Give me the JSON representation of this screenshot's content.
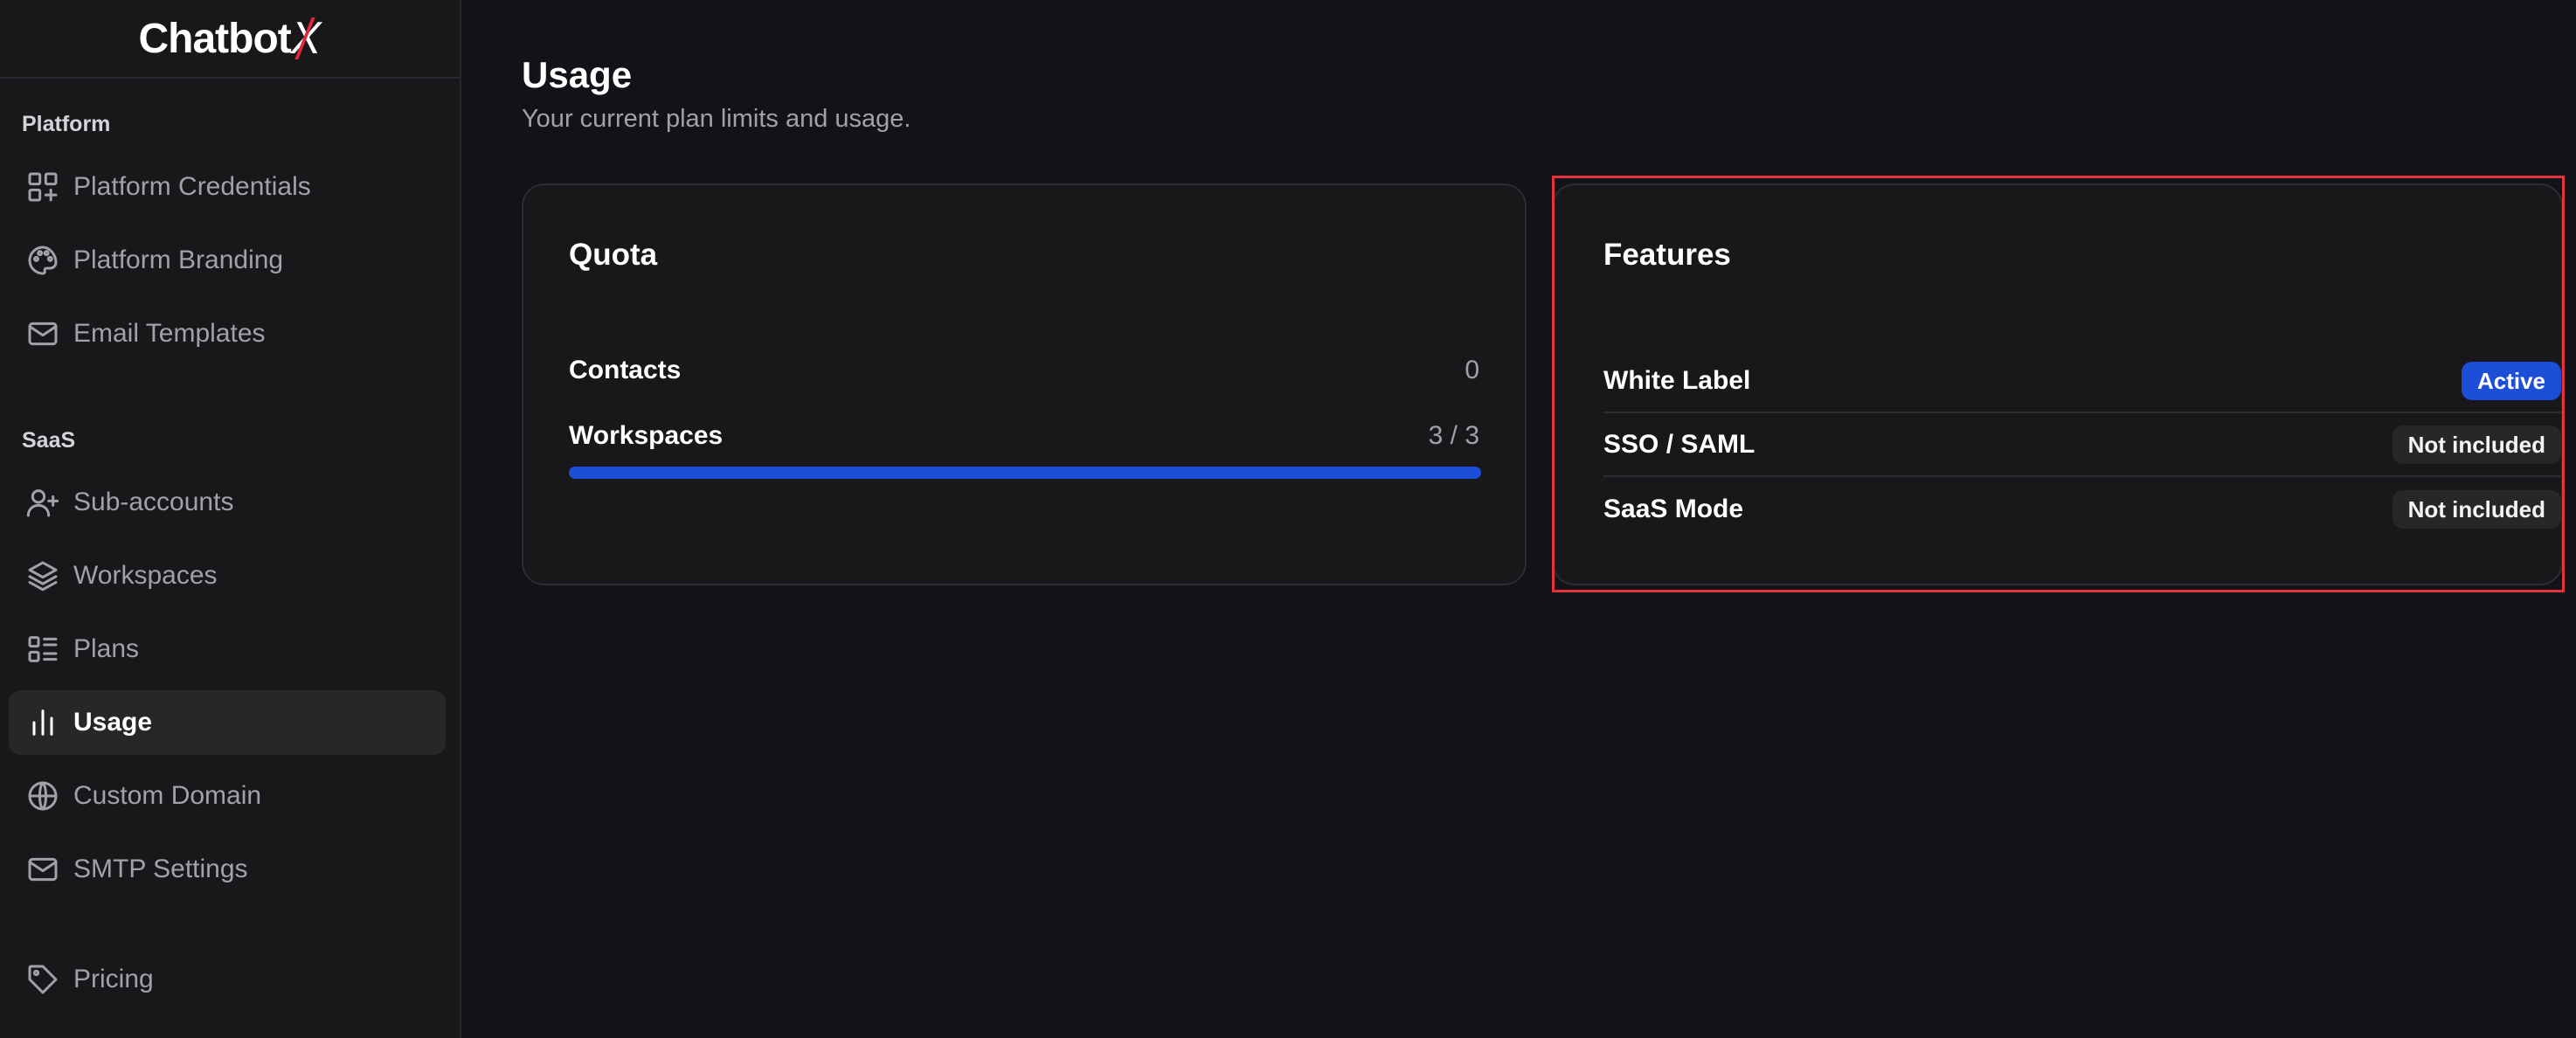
{
  "app": {
    "logo_main": "Chatbot",
    "logo_accent": "X"
  },
  "sidebar": {
    "sections": [
      {
        "label": "Platform",
        "items": [
          {
            "label": "Platform Credentials",
            "icon": "grid-plus-icon"
          },
          {
            "label": "Platform Branding",
            "icon": "palette-icon"
          },
          {
            "label": "Email Templates",
            "icon": "mail-icon"
          }
        ]
      },
      {
        "label": "SaaS",
        "items": [
          {
            "label": "Sub-accounts",
            "icon": "user-plus-icon"
          },
          {
            "label": "Workspaces",
            "icon": "layers-icon"
          },
          {
            "label": "Plans",
            "icon": "list-icon"
          },
          {
            "label": "Usage",
            "icon": "bar-chart-icon",
            "active": true
          },
          {
            "label": "Custom Domain",
            "icon": "globe-icon"
          },
          {
            "label": "SMTP Settings",
            "icon": "mail-icon"
          }
        ]
      }
    ],
    "footer_item": {
      "label": "Pricing",
      "icon": "tag-icon"
    }
  },
  "main": {
    "title": "Usage",
    "subtitle": "Your current plan limits and usage.",
    "quota": {
      "title": "Quota",
      "rows": [
        {
          "label": "Contacts",
          "value": "0"
        },
        {
          "label": "Workspaces",
          "value": "3 / 3",
          "used": 3,
          "limit": 3
        }
      ]
    },
    "features": {
      "title": "Features",
      "rows": [
        {
          "label": "White Label",
          "status": "Active"
        },
        {
          "label": "SSO / SAML",
          "status": "Not included"
        },
        {
          "label": "SaaS Mode",
          "status": "Not included"
        }
      ]
    }
  },
  "colors": {
    "accent": "#1d4ed8",
    "highlight": "#e5323b",
    "logo_accent": "#e0283a"
  }
}
